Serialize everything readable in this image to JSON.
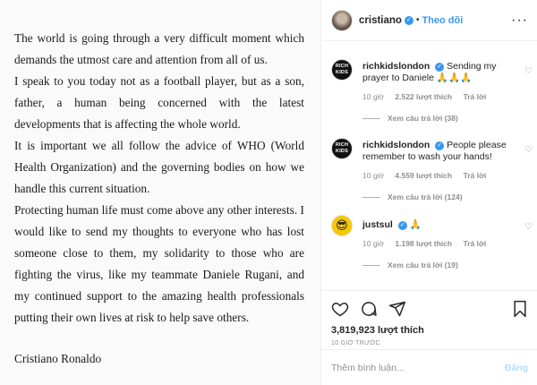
{
  "post_text": {
    "paragraphs": [
      "The world is going through a very difficult moment which demands the utmost care and attention from all of us.",
      "I speak to you today not as a football player, but as a son, father, a human being concerned with the latest developments that is affecting the whole world.",
      "It is important we all follow the advice of WHO (World Health Organization) and the governing bodies on how we handle this current situation.",
      "Protecting human life must come above any other interests. I would like to send my thoughts to everyone who has lost someone close to them, my solidarity to those who are fighting the virus, like my teammate Daniele Rugani, and my continued support to the amazing health professionals putting their own lives at risk to help save others."
    ],
    "signature": "Cristiano Ronaldo"
  },
  "header": {
    "username": "cristiano",
    "verified_icon": "verified-badge-icon",
    "separator": "•",
    "follow_label": "Theo dõi",
    "more_icon": "more-options-icon",
    "more_label": "···"
  },
  "comments": [
    {
      "username": "richkidslondon",
      "avatar_text": "RICH KIDS",
      "text": "Sending my prayer to Daniele 🙏🙏🙏",
      "time": "10 giờ",
      "likes": "2.522 lượt thích",
      "reply_label": "Trả lời",
      "view_replies": "Xem câu trả lời (38)"
    },
    {
      "username": "richkidslondon",
      "avatar_text": "RICH KIDS",
      "text": "People please remember to wash your hands!",
      "time": "10 giờ",
      "likes": "4.559 lượt thích",
      "reply_label": "Trả lời",
      "view_replies": "Xem câu trả lời (124)"
    },
    {
      "username": "justsul",
      "avatar_text": "😎",
      "text": "🙏",
      "time": "10 giờ",
      "likes": "1.198 lượt thích",
      "reply_label": "Trả lời",
      "view_replies": "Xem câu trả lời (19)"
    }
  ],
  "actions": {
    "icons": [
      "heart-icon",
      "comment-icon",
      "share-icon",
      "bookmark-icon"
    ],
    "likes": "3,819,923 lượt thích",
    "time": "10 GIỜ TRƯỚC"
  },
  "add_comment": {
    "placeholder": "Thêm bình luận...",
    "post_label": "Đăng"
  },
  "colors": {
    "accent": "#3897f0",
    "muted": "#8e8e8e",
    "post_disabled": "#b2dffc"
  }
}
